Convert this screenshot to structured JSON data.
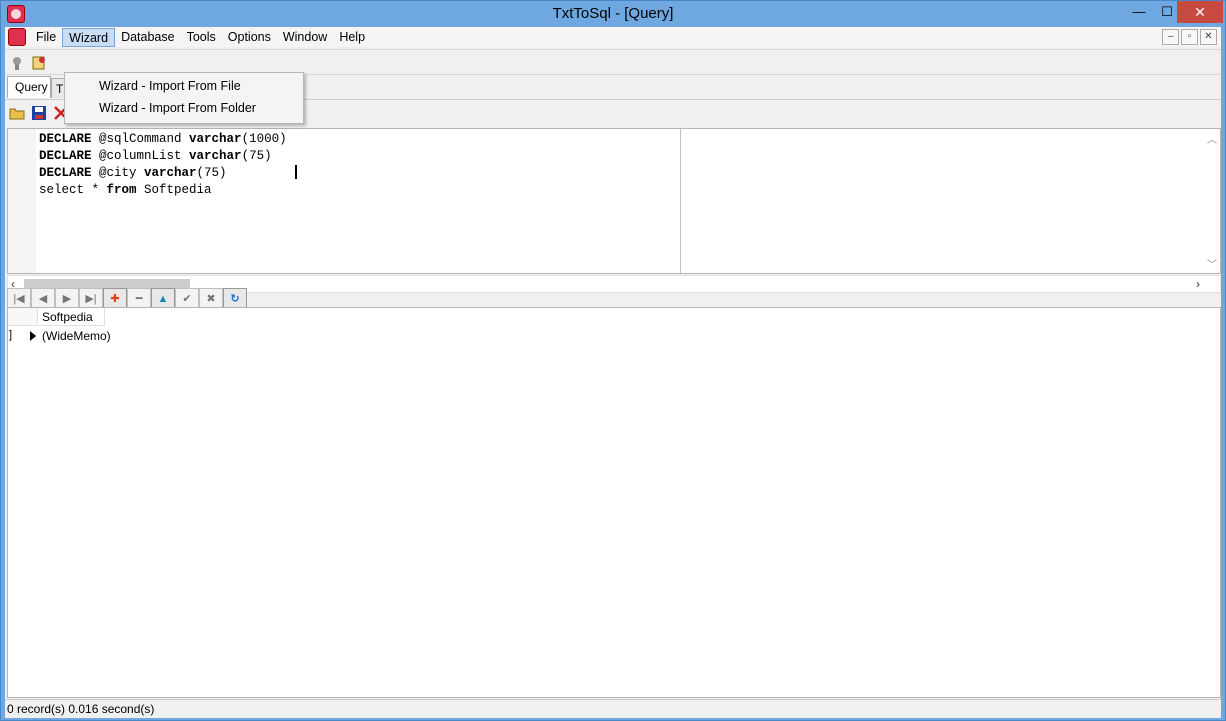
{
  "window": {
    "title": "TxtToSql - [Query]",
    "controls": {
      "minimize": "—",
      "maximize": "☐",
      "close": "✕"
    }
  },
  "menubar": {
    "items": [
      "File",
      "Wizard",
      "Database",
      "Tools",
      "Options",
      "Window",
      "Help"
    ],
    "active": "Wizard",
    "mdi_controls": [
      "–",
      "▫",
      "✕"
    ]
  },
  "wizard_menu": {
    "items": [
      "Wizard - Import From File",
      "Wizard - Import From Folder"
    ]
  },
  "tabs": [
    "Query",
    "T"
  ],
  "editor": {
    "lines": [
      {
        "kw1": "DECLARE",
        "mid": " @sqlCommand ",
        "kw2": "varchar",
        "rest": "(1000)"
      },
      {
        "kw1": "DECLARE",
        "mid": " @columnList ",
        "kw2": "varchar",
        "rest": "(75)"
      },
      {
        "kw1": "DECLARE",
        "mid": " @city ",
        "kw2": "varchar",
        "rest": "(75)"
      },
      {
        "kw1": "select",
        "mid": " * ",
        "kw2": "from",
        "rest": " Softpedia"
      }
    ]
  },
  "grid": {
    "columns": [
      "Softpedia"
    ],
    "rows": [
      [
        "(WideMemo)"
      ]
    ],
    "row_indicator": "]"
  },
  "status": "0 record(s)  0.016 second(s)",
  "colors": {
    "titlebar": "#6fa8e0",
    "close_button": "#c74a40",
    "menu_highlight": "#c8ddf3"
  }
}
